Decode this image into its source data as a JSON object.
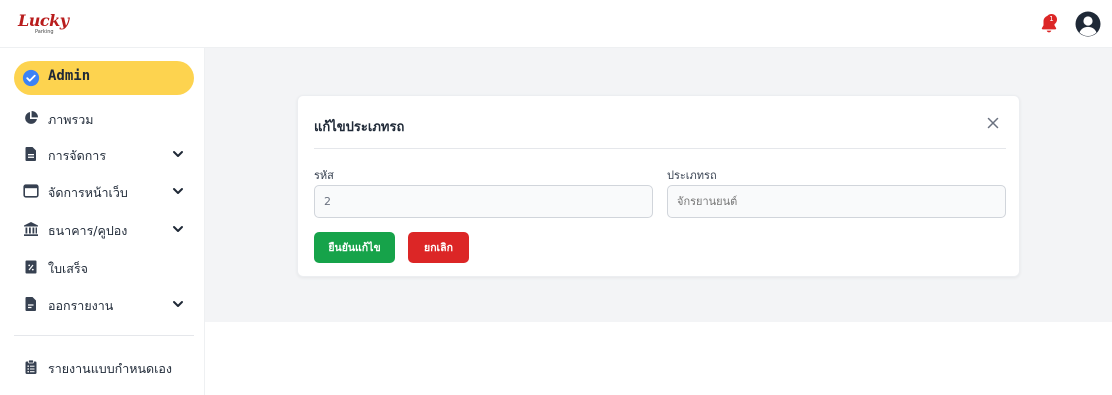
{
  "header": {
    "logo_text": "Lucky",
    "logo_subtext": "Parking",
    "notification_count": "1"
  },
  "sidebar": {
    "role_label": "Admin",
    "items": [
      {
        "label": "ภาพรวม",
        "icon": "pie-chart-icon",
        "has_submenu": false
      },
      {
        "label": "การจัดการ",
        "icon": "document-icon",
        "has_submenu": true
      },
      {
        "label": "จัดการหน้าเว็บ",
        "icon": "browser-window-icon",
        "has_submenu": true
      },
      {
        "label": "ธนาคาร/คูปอง",
        "icon": "bank-icon",
        "has_submenu": true
      },
      {
        "label": "ใบเสร็จ",
        "icon": "receipt-icon",
        "has_submenu": false
      },
      {
        "label": "ออกรายงาน",
        "icon": "report-file-icon",
        "has_submenu": true
      },
      {
        "label": "รายงานแบบกำหนดเอง",
        "icon": "clipboard-list-icon",
        "has_submenu": false
      }
    ]
  },
  "modal": {
    "title": "แก้ไขประเภทรถ",
    "code_label": "รหัส",
    "code_value": "2",
    "type_label": "ประเภทรถ",
    "type_placeholder": "จักรยานยนต์",
    "confirm_label": "ยืนยันแก้ไข",
    "cancel_label": "ยกเลิก"
  },
  "colors": {
    "accent_yellow": "#fdd34f",
    "confirm_green": "#16a34a",
    "cancel_red": "#dc2626",
    "logo_red": "#b91c1c",
    "check_blue": "#3b82f6"
  }
}
